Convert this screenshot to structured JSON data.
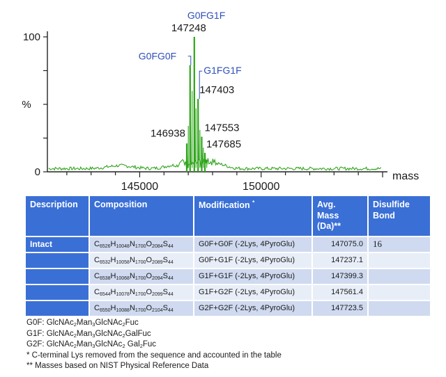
{
  "chart_data": {
    "type": "line",
    "title": "",
    "xlabel": "mass",
    "ylabel": "%",
    "xlim": [
      141200,
      155200
    ],
    "ylim": [
      0,
      100
    ],
    "x_ticks": [
      "145000",
      "150000"
    ],
    "y_ticks": [
      "0",
      "100"
    ],
    "y_mid_label": "%",
    "line_color": "#2fa51a",
    "series": [
      {
        "values": [
          {
            "x": 146938,
            "y": 21
          },
          {
            "x": 147075,
            "y": 79
          },
          {
            "x": 147248,
            "y": 100
          },
          {
            "x": 147403,
            "y": 54
          },
          {
            "x": 147553,
            "y": 26
          },
          {
            "x": 147685,
            "y": 14
          }
        ]
      }
    ],
    "annotations": [
      {
        "text": "G0FG1F",
        "x": 147248,
        "y": 100,
        "color": "#2e4fb8"
      },
      {
        "text": "147248",
        "x": 147248,
        "y": 100,
        "color": "#1a1a1a"
      },
      {
        "text": "G0FG0F",
        "x": 147075,
        "y": 79,
        "color": "#2e4fb8"
      },
      {
        "text": "G1FG1F",
        "x": 147403,
        "y": 54,
        "color": "#2e4fb8"
      },
      {
        "text": "147403",
        "x": 147403,
        "y": 54,
        "color": "#1a1a1a"
      },
      {
        "text": "146938",
        "x": 146938,
        "y": 21,
        "color": "#1a1a1a"
      },
      {
        "text": "147553",
        "x": 147553,
        "y": 26,
        "color": "#1a1a1a"
      },
      {
        "text": "147685",
        "x": 147685,
        "y": 14,
        "color": "#1a1a1a"
      }
    ]
  },
  "table": {
    "headers": {
      "description": "Description",
      "composition": "Composition",
      "modification": "Modification",
      "modification_mark": "*",
      "avg_mass_line1": "Avg.",
      "avg_mass_line2": "Mass",
      "avg_mass_line3": "(Da)**",
      "disulfide_line1": "Disulfide",
      "disulfide_line2": "Bond"
    },
    "rows": [
      {
        "description": "Intact",
        "composition": [
          [
            "C",
            "6526"
          ],
          [
            "H",
            "10048"
          ],
          [
            "N",
            "1700"
          ],
          [
            "O",
            "2084"
          ],
          [
            "S",
            "44"
          ]
        ],
        "modification": "G0F+G0F (-2Lys, 4PyroGlu)",
        "mass": "147075.0",
        "bond": "16"
      },
      {
        "description": "",
        "composition": [
          [
            "C",
            "6532"
          ],
          [
            "H",
            "10058"
          ],
          [
            "N",
            "1700"
          ],
          [
            "O",
            "2089"
          ],
          [
            "S",
            "44"
          ]
        ],
        "modification": "G0F+G1F (-2Lys, 4PyroGlu)",
        "mass": "147237.1",
        "bond": ""
      },
      {
        "description": "",
        "composition": [
          [
            "C",
            "6538"
          ],
          [
            "H",
            "10068"
          ],
          [
            "N",
            "1700"
          ],
          [
            "O",
            "2094"
          ],
          [
            "S",
            "44"
          ]
        ],
        "modification": "G1F+G1F (-2Lys, 4PyroGlu)",
        "mass": "147399.3",
        "bond": ""
      },
      {
        "description": "",
        "composition": [
          [
            "C",
            "6544"
          ],
          [
            "H",
            "10078"
          ],
          [
            "N",
            "1700"
          ],
          [
            "O",
            "2099"
          ],
          [
            "S",
            "44"
          ]
        ],
        "modification": "G1F+G2F (-2Lys, 4PyroGlu)",
        "mass": "147561.4",
        "bond": ""
      },
      {
        "description": "",
        "composition": [
          [
            "C",
            "6550"
          ],
          [
            "H",
            "10088"
          ],
          [
            "N",
            "1700"
          ],
          [
            "O",
            "2104"
          ],
          [
            "S",
            "44"
          ]
        ],
        "modification": "G2F+G2F (-2Lys, 4PyroGlu)",
        "mass": "147723.5",
        "bond": ""
      }
    ]
  },
  "notes": {
    "g0f": [
      [
        "G0F: GlcNAc",
        ""
      ],
      [
        "",
        "2"
      ],
      [
        "Man",
        ""
      ],
      [
        "",
        "3"
      ],
      [
        "GlcNAc",
        ""
      ],
      [
        "",
        "2"
      ],
      [
        "Fuc",
        ""
      ]
    ],
    "g1f": [
      [
        "G1F: GlcNAc",
        ""
      ],
      [
        "",
        "2"
      ],
      [
        "Man",
        ""
      ],
      [
        "",
        "3"
      ],
      [
        "GlcNAc",
        ""
      ],
      [
        "",
        "2"
      ],
      [
        "GalFuc",
        ""
      ]
    ],
    "g2f": [
      [
        "G2F: GlcNAc",
        ""
      ],
      [
        "",
        "2"
      ],
      [
        "Man",
        ""
      ],
      [
        "",
        "3"
      ],
      [
        "GlcNAc",
        ""
      ],
      [
        "",
        "2"
      ],
      [
        " Gal",
        ""
      ],
      [
        "",
        "2"
      ],
      [
        "Fuc",
        ""
      ]
    ],
    "footnote1": "*  C-terminal Lys removed from the sequence and accounted in the table",
    "footnote2": "**  Masses based on NIST Physical Reference Data"
  }
}
